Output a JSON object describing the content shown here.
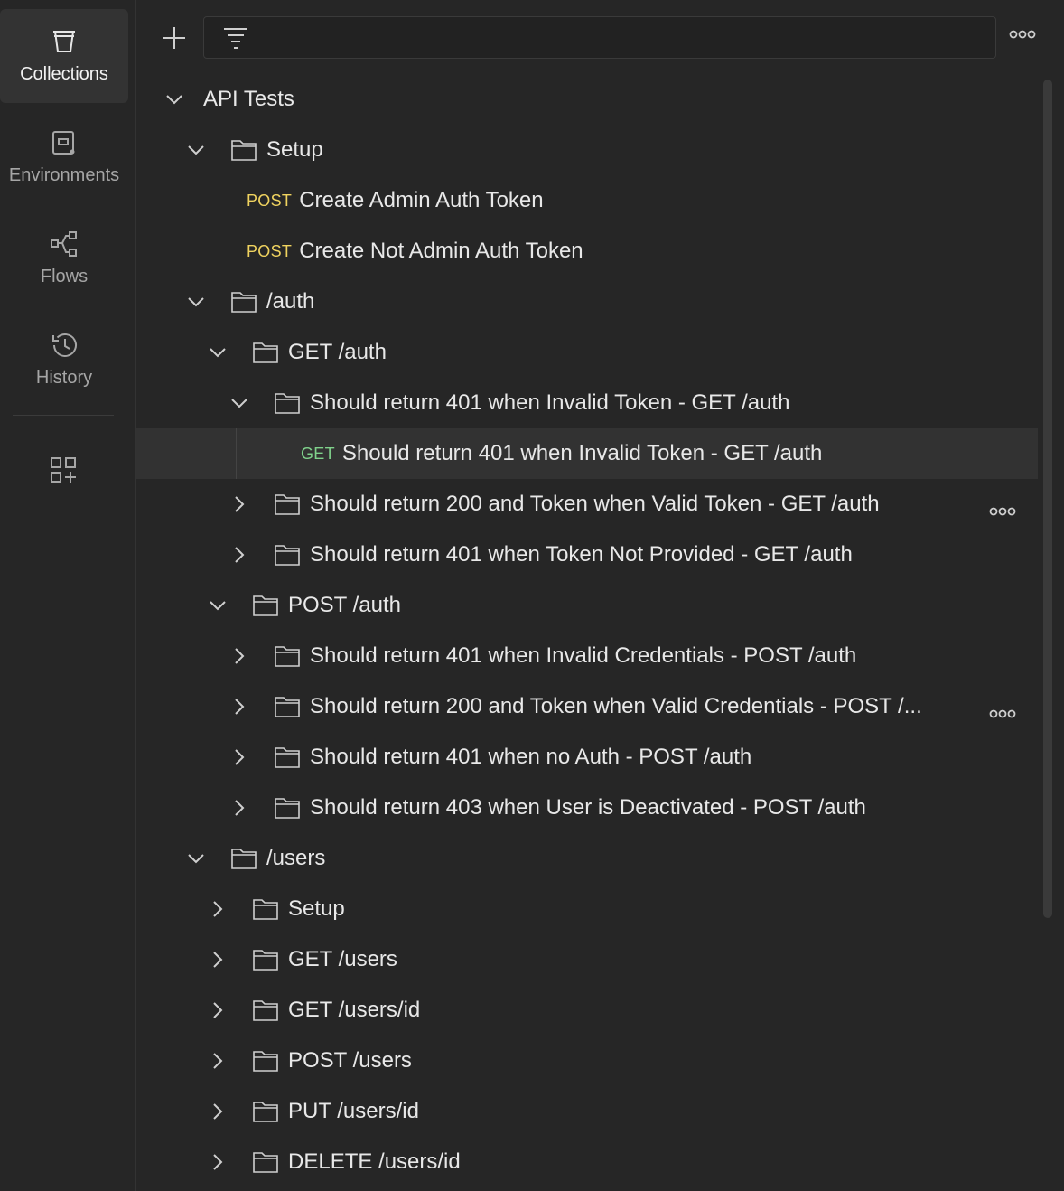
{
  "rail": {
    "items": [
      {
        "label": "Collections",
        "icon": "trash-cup-icon"
      },
      {
        "label": "Environments",
        "icon": "environment-icon"
      },
      {
        "label": "Flows",
        "icon": "flows-icon"
      },
      {
        "label": "History",
        "icon": "history-icon"
      }
    ],
    "extra_icon": "add-widget-icon"
  },
  "toolbar": {
    "add_icon": "plus-icon",
    "filter_icon": "filter-icon",
    "more_icon": "more-dots-icon"
  },
  "tree": {
    "root": "API Tests",
    "rows": [
      {
        "label": "Setup"
      },
      {
        "method": "POST",
        "label": "Create Admin Auth Token"
      },
      {
        "method": "POST",
        "label": "Create Not Admin Auth Token"
      },
      {
        "label": "/auth"
      },
      {
        "label": "GET /auth"
      },
      {
        "label": "Should return 401 when Invalid Token - GET /auth"
      },
      {
        "method": "GET",
        "label": "Should return 401 when Invalid Token - GET /auth"
      },
      {
        "label": "Should return 200 and Token when Valid Token - GET /auth"
      },
      {
        "label": "Should return 401 when Token Not Provided - GET /auth"
      },
      {
        "label": "POST /auth"
      },
      {
        "label": "Should return 401 when Invalid Credentials - POST /auth"
      },
      {
        "label": "Should return 200 and Token when Valid Credentials - POST /..."
      },
      {
        "label": "Should return 401 when no Auth - POST /auth"
      },
      {
        "label": "Should return 403 when User is Deactivated - POST /auth"
      },
      {
        "label": "/users"
      },
      {
        "label": "Setup"
      },
      {
        "label": "GET /users"
      },
      {
        "label": "GET /users/id"
      },
      {
        "label": "POST /users"
      },
      {
        "label": "PUT /users/id"
      },
      {
        "label": "DELETE /users/id"
      }
    ]
  },
  "colors": {
    "post": "#f0d35f",
    "get": "#7fd18b",
    "background": "#262626",
    "selected": "#323232"
  }
}
